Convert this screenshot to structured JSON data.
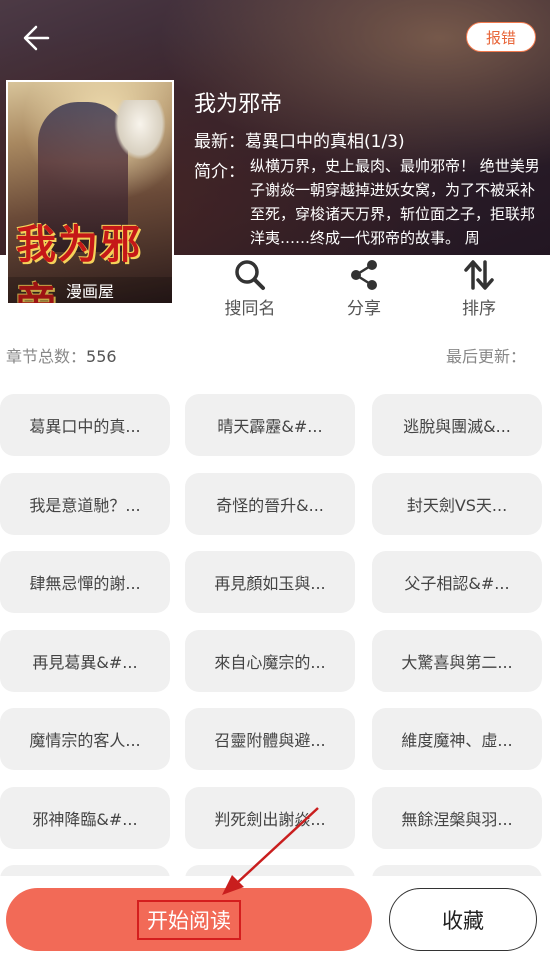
{
  "header": {
    "back_icon": "back-arrow-icon",
    "report_label": "报错"
  },
  "book": {
    "cover_title_art": "我为邪帝",
    "cover_source": "漫画屋",
    "title": "我为邪帝",
    "latest": "最新：葛異口中的真相(1/3)",
    "intro_label": "简介：",
    "intro_text": "纵横万界，史上最肉、最帅邪帝！ 绝世美男子谢焱一朝穿越掉进妖女窝，为了不被采补至死，穿梭诸天万界，斩位面之子，拒联邦洋夷……终成一代邪帝的故事。 周"
  },
  "actions": [
    {
      "label": "搜同名",
      "icon": "search-icon"
    },
    {
      "label": "分享",
      "icon": "share-icon"
    },
    {
      "label": "排序",
      "icon": "sort-icon"
    }
  ],
  "stats": {
    "chapters_label": "章节总数：",
    "chapters_count": "556",
    "last_update_label": "最后更新："
  },
  "chapters": [
    "葛異口中的真...",
    "晴天霹靂&#...",
    "逃脫與團滅&...",
    "我是意道馳？...",
    "奇怪的晉升&...",
    "封天劍VS天...",
    "肆無忌憚的謝...",
    "再見顏如玉與...",
    "父子相認&#...",
    "再見葛異&#...",
    "來自心魔宗的...",
    "大驚喜與第二...",
    "魔情宗的客人...",
    "召靈附體與避...",
    "維度魔神、虛...",
    "邪神降臨&#...",
    "判死劍出謝焱...",
    "無餘涅槃與羽..."
  ],
  "footer": {
    "start_label": "开始阅读",
    "favorite_label": "收藏"
  },
  "colors": {
    "accent": "#f26a57",
    "report_border": "#f27a4e",
    "annotation_red": "#d41e1e"
  }
}
